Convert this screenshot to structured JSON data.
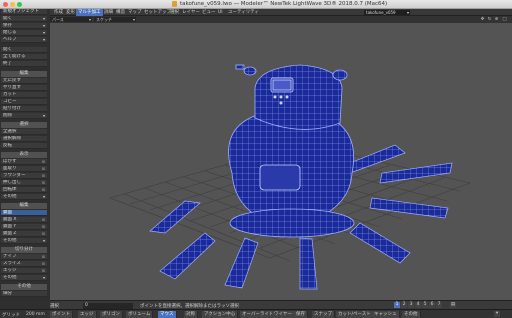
{
  "window": {
    "title": "takofune_v059.lwo — Modeler™ NewTek LightWave 3D® 2018.0.7 (Mac64)"
  },
  "tabs": [
    {
      "label": "作成"
    },
    {
      "label": "変形"
    },
    {
      "label": "マルチ加工"
    },
    {
      "label": "詳細"
    },
    {
      "label": "構造"
    },
    {
      "label": "マップ"
    },
    {
      "label": "セットアップ"
    },
    {
      "label": "選択"
    },
    {
      "label": "レイヤー"
    },
    {
      "label": "ビュー"
    },
    {
      "label": "UI"
    },
    {
      "label": "ユーティリティ"
    }
  ],
  "active_tab_index": 2,
  "file_dropdown": "takofune_v059",
  "left_panel": {
    "file_items": [
      {
        "label": "新規オブジェクト"
      },
      {
        "label": "開く"
      },
      {
        "label": "保存"
      },
      {
        "label": "閉じる"
      },
      {
        "label": "ヘルプ"
      }
    ],
    "misc_items": [
      {
        "label": "開く"
      },
      {
        "label": "全て開ける"
      },
      {
        "label": "終了"
      }
    ],
    "sec_edit": "編集",
    "edit_items": [
      {
        "label": "元に戻す"
      },
      {
        "label": "やり直す"
      },
      {
        "label": "カット"
      },
      {
        "label": "コピー"
      },
      {
        "label": "貼り付け"
      },
      {
        "label": "削除"
      }
    ],
    "sec_select": "選択",
    "select_items": [
      {
        "label": "全選択"
      },
      {
        "label": "選択解除"
      },
      {
        "label": "反転"
      }
    ],
    "sec_view": "表示",
    "view_items": [
      {
        "label": "ぼかす"
      },
      {
        "label": "面取り"
      },
      {
        "label": "ラウンダー"
      },
      {
        "label": "押し出し"
      },
      {
        "label": "回転体"
      },
      {
        "label": "その他"
      }
    ],
    "sec_edit2": "編集",
    "edit2_items": [
      {
        "label": "鏡面"
      },
      {
        "label": "鏡面 X"
      },
      {
        "label": "鏡面 Y"
      },
      {
        "label": "鏡面 Z"
      },
      {
        "label": "その他"
      }
    ],
    "sec_cut": "切り分け",
    "cut_items": [
      {
        "label": "ナイフ"
      },
      {
        "label": "スライス"
      },
      {
        "label": "エッジ"
      },
      {
        "label": "その他"
      }
    ],
    "sec_misc": "その他",
    "misc2_items": [
      {
        "label": "細分"
      }
    ]
  },
  "viewport": {
    "view_mode": "パース",
    "shading_mode": "スケッチ"
  },
  "status_bar": {
    "selection_label": "選択",
    "selection_count": "0",
    "hint": "ポイントを直接選択。選択解除またはラッソ選択",
    "grid_label": "グリッド",
    "grid_value": "200 mm",
    "modes": [
      {
        "label": "ポイント"
      },
      {
        "label": "エッジ"
      },
      {
        "label": "ポリゴン"
      },
      {
        "label": "ボリューム"
      },
      {
        "label": "マウス"
      },
      {
        "label": "対称"
      },
      {
        "label": "アクション中心"
      },
      {
        "label": "オーバーライド"
      },
      {
        "label": "ワイヤー"
      },
      {
        "label": "保存"
      },
      {
        "label": "スナップ"
      },
      {
        "label": "カット/ペースト"
      },
      {
        "label": "キャッシュ"
      },
      {
        "label": "その他"
      }
    ],
    "active_mode_index": 4,
    "layer_buttons": [
      "1",
      "2",
      "3",
      "4",
      "5",
      "6",
      "7"
    ]
  },
  "colors": {
    "accent": "#4a72c0",
    "viewport_bg": "#545454",
    "mesh_fill": "#1a2a9a",
    "mesh_wire": "#9fb0ff"
  }
}
